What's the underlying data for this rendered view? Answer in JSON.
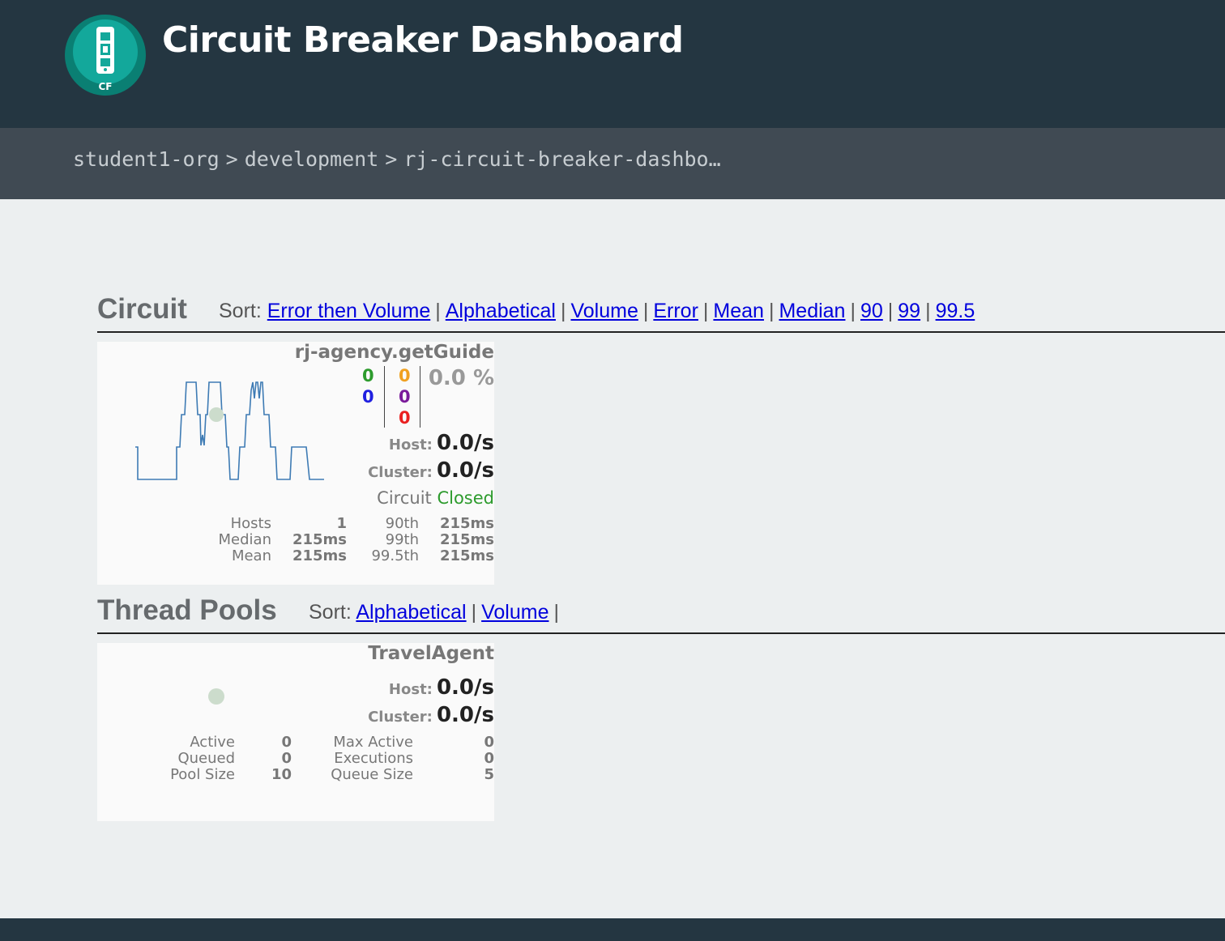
{
  "header": {
    "title": "Circuit Breaker Dashboard",
    "logo_text": "CF",
    "logo_colors": {
      "outer": "#0a7f73",
      "inner": "#13a89b"
    }
  },
  "breadcrumb": {
    "items": [
      "student1-org",
      "development",
      "rj-circuit-breaker-dashbo…"
    ],
    "separator": ">"
  },
  "circuit_section": {
    "title": "Circuit",
    "sort_label": "Sort:",
    "sort_options": [
      "Error then Volume",
      "Alphabetical",
      "Volume",
      "Error",
      "Mean",
      "Median",
      "90",
      "99",
      "99.5"
    ],
    "separator": "|"
  },
  "circuit": {
    "name": "rj-agency.getGuide",
    "counts": {
      "success": "0",
      "short_circuited": "0",
      "bad_request": "0",
      "timeout": "0",
      "rejected": "0",
      "failure": "0"
    },
    "count_colors": {
      "success": "#2d9b2d",
      "short_circuited": "#2020e0",
      "bad_request": "#f0a020",
      "timeout": "#7a1a9a",
      "rejected": "#ea2020"
    },
    "error_percentage": "0.0 %",
    "host_label": "Host:",
    "host_rate": "0.0/s",
    "cluster_label": "Cluster:",
    "cluster_rate": "0.0/s",
    "circuit_label": "Circuit",
    "circuit_status": "Closed",
    "stats": {
      "hosts_label": "Hosts",
      "hosts_value": "1",
      "median_label": "Median",
      "median_value": "215ms",
      "mean_label": "Mean",
      "mean_value": "215ms",
      "p90_label": "90th",
      "p90_value": "215ms",
      "p99_label": "99th",
      "p99_value": "215ms",
      "p995_label": "99.5th",
      "p995_value": "215ms"
    },
    "sparkline_color": "#3e7bb4"
  },
  "threadpool_section": {
    "title": "Thread Pools",
    "sort_label": "Sort:",
    "sort_options": [
      "Alphabetical",
      "Volume"
    ],
    "separator": "|"
  },
  "threadpool": {
    "name": "TravelAgent",
    "host_label": "Host:",
    "host_rate": "0.0/s",
    "cluster_label": "Cluster:",
    "cluster_rate": "0.0/s",
    "stats": {
      "active_label": "Active",
      "active_value": "0",
      "queued_label": "Queued",
      "queued_value": "0",
      "pool_size_label": "Pool Size",
      "pool_size_value": "10",
      "max_active_label": "Max Active",
      "max_active_value": "0",
      "executions_label": "Executions",
      "executions_value": "0",
      "queue_size_label": "Queue Size",
      "queue_size_value": "5"
    }
  }
}
